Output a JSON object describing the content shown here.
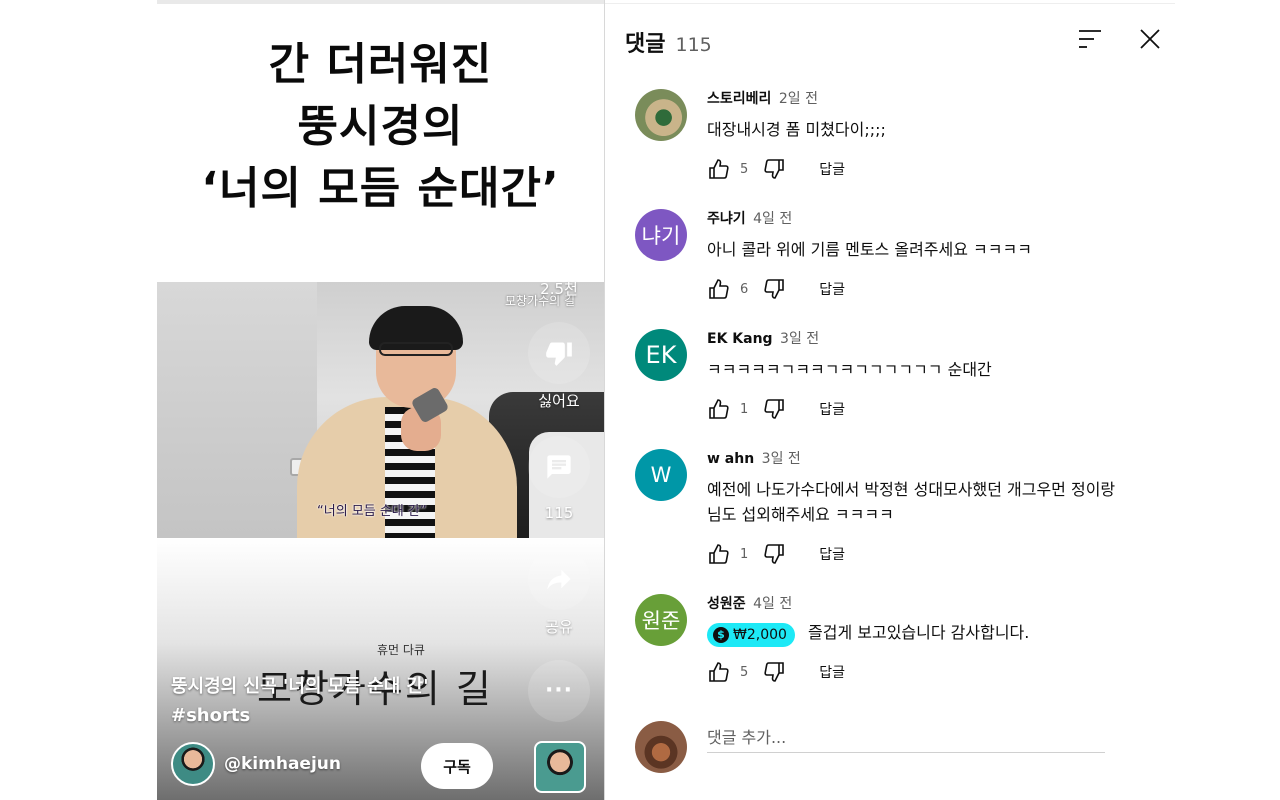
{
  "video": {
    "headline": [
      "간 더러워진",
      "뚱시경의",
      "‘너의 모듬 순대간’"
    ],
    "watermark": "모창가수의 길",
    "scene_caption": "“너의 모듬 순대 간”",
    "sub_small": "휴먼 다큐",
    "show_title": "모창가수의 길",
    "description_line1": "뚱시경의 신곡 '너의 모듬 순대 간'",
    "description_line2": "#shorts",
    "channel_handle": "@kimhaejun",
    "subscribe_label": "구독",
    "actions": {
      "like_count": "2.5천",
      "dislike_label": "싫어요",
      "comment_count": "115",
      "share_label": "공유"
    }
  },
  "comments_panel": {
    "title": "댓글",
    "count": "115",
    "comments": [
      {
        "author": "스토리베리",
        "time": "2일 전",
        "text": "대장내시경 폼 미쳤다이;;;;",
        "likes": "5",
        "reply_label": "답글",
        "avatar_text": "",
        "avatar_color": "#7a8c5a"
      },
      {
        "author": "주냐기",
        "time": "4일 전",
        "text": "아니 콜라 위에 기름 멘토스 올려주세요 ㅋㅋㅋㅋ",
        "likes": "6",
        "reply_label": "답글",
        "avatar_text": "냐기",
        "avatar_color": "#7e57c2"
      },
      {
        "author": "EK Kang",
        "time": "3일 전",
        "text": "ㅋㅋㅋㅋㅋㄱㅋㅋㄱㅋㄱㄱㄱㄱㄱㄱ 순대간",
        "likes": "1",
        "reply_label": "답글",
        "avatar_text": "EK",
        "avatar_color": "#00897b"
      },
      {
        "author": "w ahn",
        "time": "3일 전",
        "text": "예전에 나도가수다에서 박정현 성대모사했던 개그우먼 정이랑 님도 섭외해주세요 ㅋㅋㅋㅋ",
        "likes": "1",
        "reply_label": "답글",
        "avatar_text": "W",
        "avatar_color": "#0097a7"
      },
      {
        "author": "성원준",
        "time": "4일 전",
        "donation": "₩2,000",
        "text": "즐겁게 보고있습니다 감사합니다.",
        "likes": "5",
        "reply_label": "답글",
        "avatar_text": "원준",
        "avatar_color": "#689f38"
      }
    ],
    "add_comment_placeholder": "댓글 추가..."
  },
  "icons": {
    "sort": "sort-icon",
    "close": "close-icon",
    "like": "thumb-up-icon",
    "dislike": "thumb-down-icon",
    "comment": "comment-icon",
    "share": "share-icon",
    "more": "more-icon"
  },
  "colors": {
    "donation_chip": "#1de9f6",
    "text_primary": "#0f0f0f",
    "text_secondary": "#606060"
  }
}
